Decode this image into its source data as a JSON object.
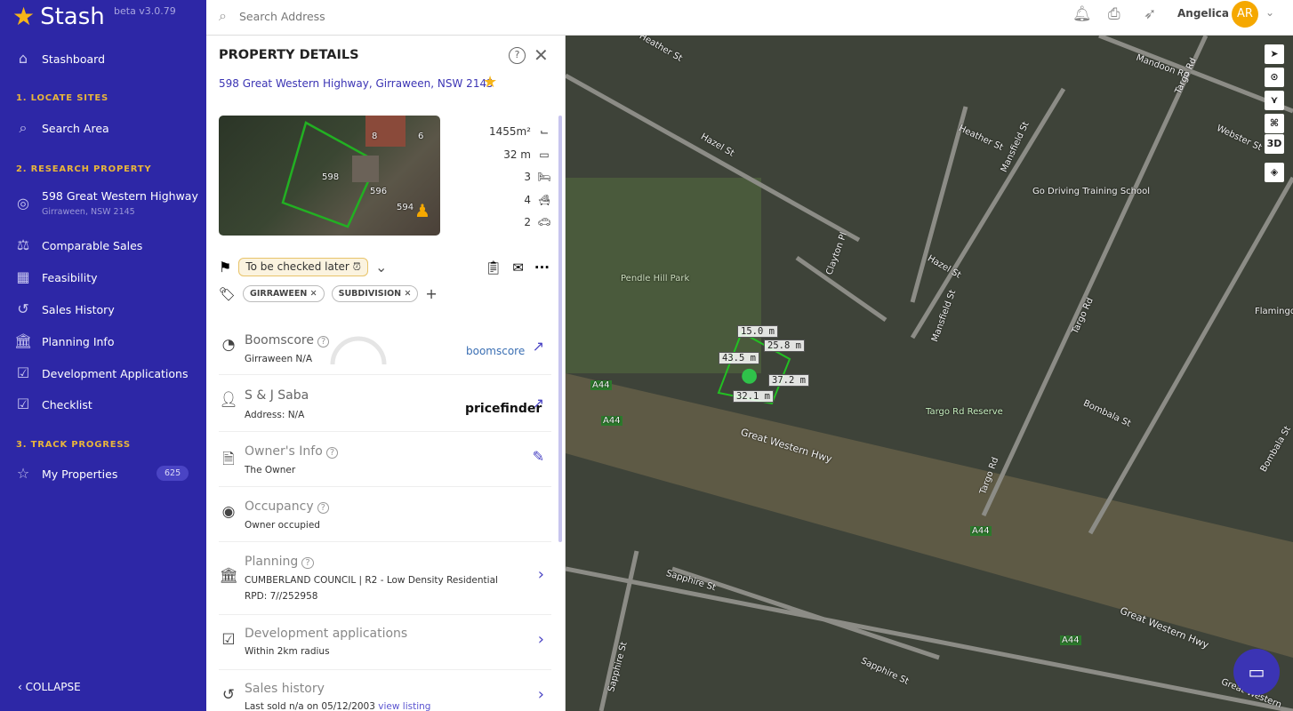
{
  "app": {
    "name": "Stash",
    "version": "beta v3.0.79"
  },
  "sidebar": {
    "stashboard": "Stashboard",
    "section1": "1. LOCATE SITES",
    "search_area": "Search Area",
    "section2": "2. RESEARCH PROPERTY",
    "property": {
      "line1": "598 Great Western Highway",
      "line2": "Girraween, NSW 2145"
    },
    "items": [
      "Comparable Sales",
      "Feasibility",
      "Sales History",
      "Planning Info",
      "Development Applications",
      "Checklist"
    ],
    "section3": "3. TRACK PROGRESS",
    "my_properties": "My Properties",
    "my_properties_count": "625",
    "collapse": "COLLAPSE"
  },
  "topbar": {
    "search_placeholder": "Search Address",
    "user": "Angelica",
    "initials": "AR"
  },
  "panel": {
    "title": "PROPERTY DETAILS",
    "address": "598 Great Western Highway, Girraween, NSW 2145",
    "thumb_labels": [
      "598",
      "596",
      "594",
      "6",
      "8"
    ],
    "stats": {
      "area": "1455m²",
      "frontage": "32 m",
      "beds": "3",
      "baths": "4",
      "cars": "2"
    },
    "status": "To be checked later",
    "tags": [
      "GIRRAWEEN",
      "SUBDIVISION"
    ],
    "boomscore": {
      "title": "Boomscore",
      "sub": "Girraween N/A",
      "brand": "boomscore"
    },
    "owner": {
      "title": "S & J Saba",
      "sub": "Address: N/A",
      "brand": "pricefinder"
    },
    "owners_info": {
      "title": "Owner's Info",
      "sub": "The Owner"
    },
    "occupancy": {
      "title": "Occupancy",
      "sub": "Owner occupied"
    },
    "planning": {
      "title": "Planning",
      "sub": "CUMBERLAND COUNCIL | R2 - Low Density Residential",
      "sub2": "RPD: 7//252958"
    },
    "dev_apps": {
      "title": "Development applications",
      "sub": "Within 2km radius"
    },
    "sales": {
      "title": "Sales history",
      "sub": "Last sold n/a on 05/12/2003",
      "link": "view listing"
    }
  },
  "map": {
    "labels": [
      "Heather St",
      "Mandoon Rd",
      "Targo Rd",
      "Webster St",
      "Hazel St",
      "Heather St",
      "Mansfield St",
      "Go Driving Training School",
      "Clayton Pl",
      "Hazel St",
      "Pendle Hill Park",
      "Mansfield St",
      "Targo Rd",
      "Flamingo",
      "Targo Rd Reserve",
      "Bombala St",
      "Bombala St",
      "Great Western Hwy",
      "Targo Rd",
      "A44",
      "A44",
      "A44",
      "A44",
      "Sapphire St",
      "Great Western Hwy",
      "Sapphire St",
      "Sapphire St",
      "Great Western"
    ],
    "measurements": [
      "15.0 m",
      "25.8 m",
      "43.5 m",
      "37.2 m",
      "32.1 m"
    ],
    "controls": {
      "three_d": "3D"
    }
  },
  "colors": {
    "sidebar": "#2d27a6",
    "accent": "#3b34b4",
    "star": "#f7b519"
  }
}
